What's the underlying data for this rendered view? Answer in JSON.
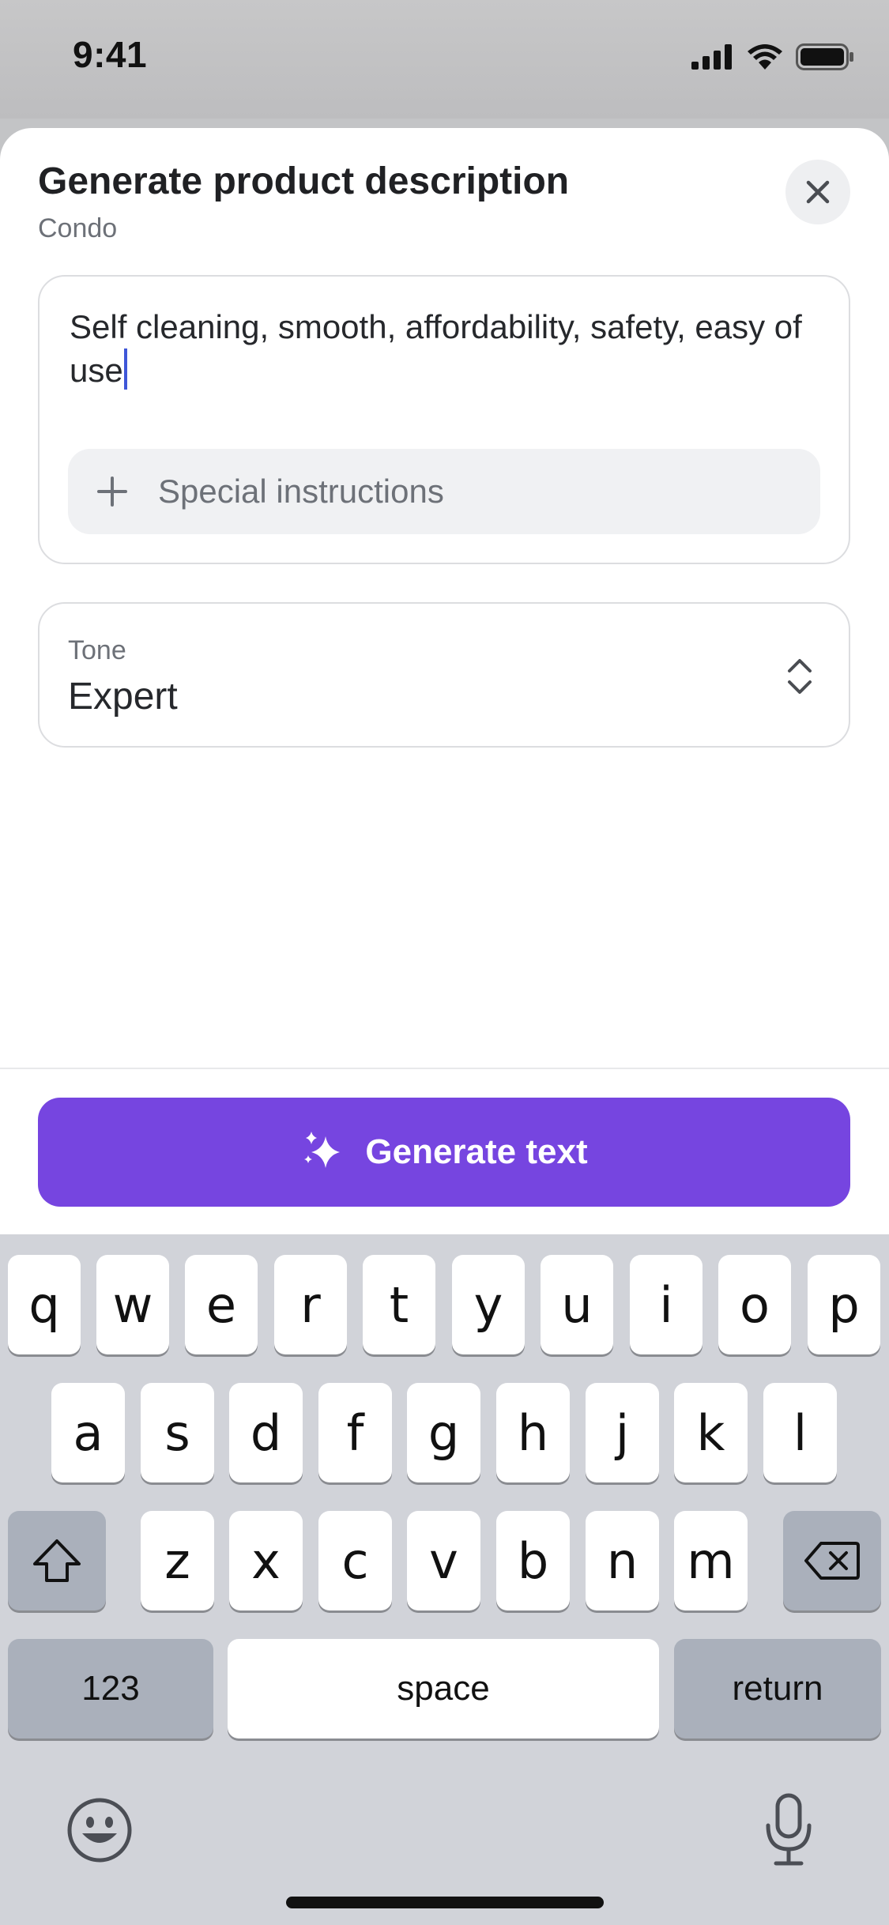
{
  "status_bar": {
    "time": "9:41"
  },
  "sheet": {
    "title": "Generate product description",
    "subtitle": "Condo",
    "input_text": "Self cleaning, smooth, affordability, safety, easy of use",
    "special_instructions_label": "Special instructions",
    "tone_label": "Tone",
    "tone_value": "Expert",
    "generate_label": "Generate text"
  },
  "colors": {
    "accent": "#7645e0",
    "caret": "#3f57d8",
    "keyboard_bg": "#d1d3d9"
  },
  "keyboard": {
    "row1": [
      "q",
      "w",
      "e",
      "r",
      "t",
      "y",
      "u",
      "i",
      "o",
      "p"
    ],
    "row2": [
      "a",
      "s",
      "d",
      "f",
      "g",
      "h",
      "j",
      "k",
      "l"
    ],
    "row3": [
      "z",
      "x",
      "c",
      "v",
      "b",
      "n",
      "m"
    ],
    "numbers_label": "123",
    "space_label": "space",
    "return_label": "return"
  },
  "icons": [
    "signal-icon",
    "wifi-icon",
    "battery-icon",
    "close-icon",
    "plus-icon",
    "chevron-updown-icon",
    "sparkle-icon",
    "shift-icon",
    "backspace-icon",
    "emoji-icon",
    "microphone-icon"
  ]
}
